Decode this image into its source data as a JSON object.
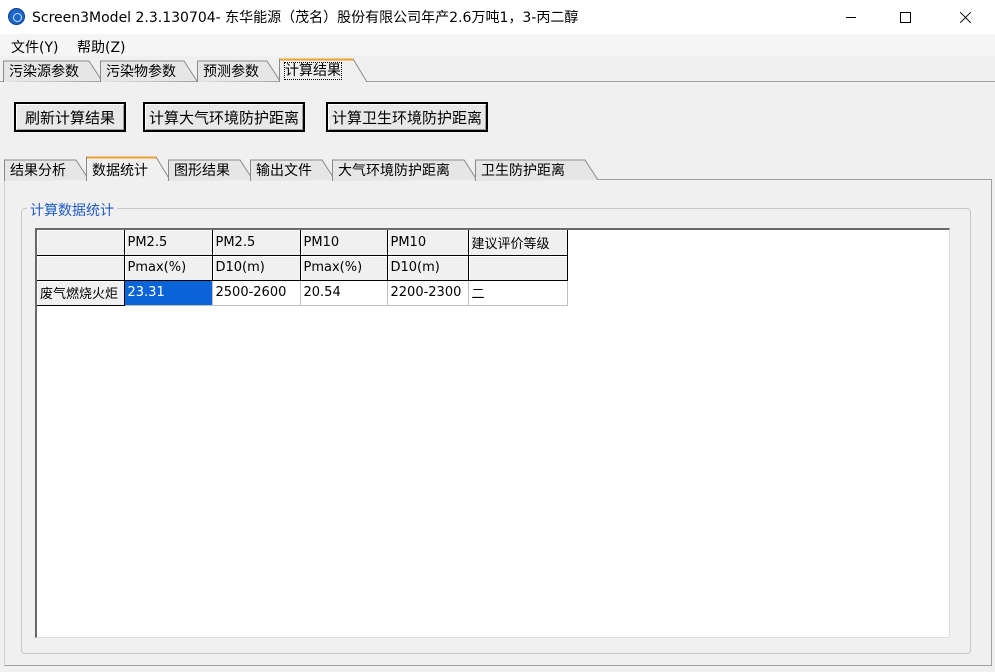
{
  "window": {
    "title": "Screen3Model 2.3.130704- 东华能源（茂名）股份有限公司年产2.6万吨1，3-丙二醇"
  },
  "menu": {
    "items": [
      {
        "label": "文件(Y)"
      },
      {
        "label": "帮助(Z)"
      }
    ]
  },
  "outer_tabs": [
    {
      "label": "污染源参数"
    },
    {
      "label": "污染物参数"
    },
    {
      "label": "预测参数"
    },
    {
      "label": "计算结果",
      "active": true
    }
  ],
  "toolbar": {
    "refresh_label": "刷新计算结果",
    "air_distance_label": "计算大气环境防护距离",
    "health_distance_label": "计算卫生环境防护距离"
  },
  "inner_tabs": [
    {
      "label": "结果分析"
    },
    {
      "label": "数据统计",
      "active": true
    },
    {
      "label": "图形结果"
    },
    {
      "label": "输出文件"
    },
    {
      "label": "大气环境防护距离"
    },
    {
      "label": "卫生防护距离"
    }
  ],
  "group": {
    "title": "计算数据统计"
  },
  "grid": {
    "header_row1": [
      "",
      "PM2.5",
      "PM2.5",
      "PM10",
      "PM10",
      "建议评价等级"
    ],
    "header_row2": [
      "",
      "Pmax(%)",
      "D10(m)",
      "Pmax(%)",
      "D10(m)",
      ""
    ],
    "rows": [
      {
        "name": "废气燃烧火炬",
        "cells": [
          "23.31",
          "2500-2600",
          "20.54",
          "2200-2300",
          "二"
        ]
      }
    ],
    "selected_cell": "23.31"
  },
  "colors": {
    "accent_tab": "#f0a030",
    "selection": "#0a64d8",
    "group_title": "#1e5bc6"
  }
}
